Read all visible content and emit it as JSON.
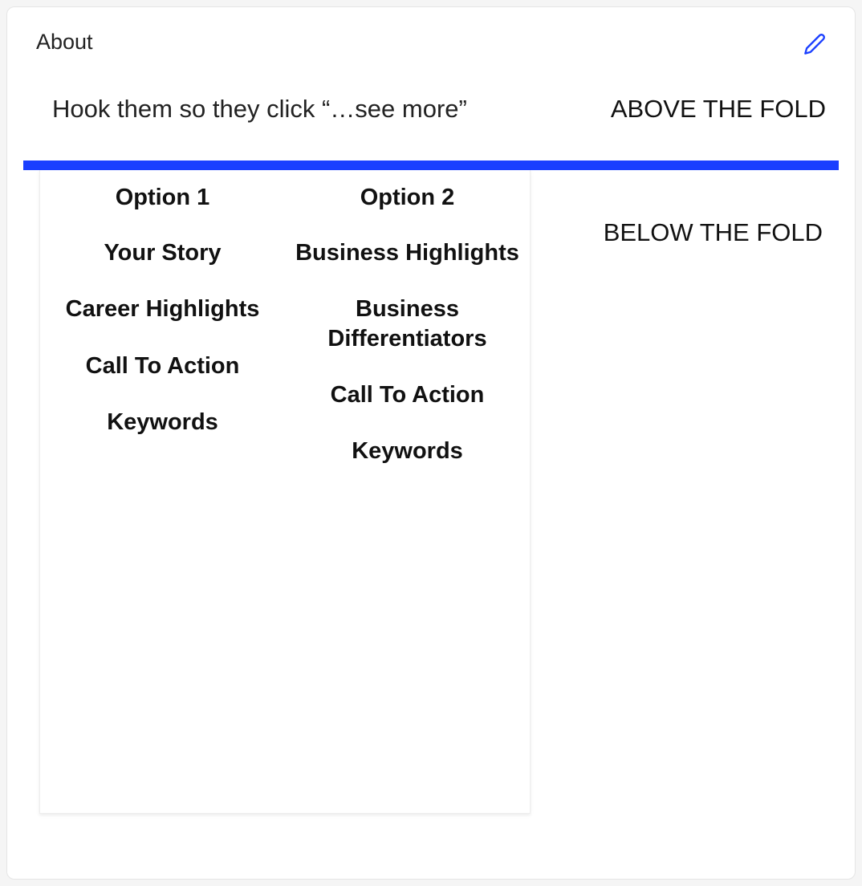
{
  "section": {
    "title": "About",
    "hook": "Hook them so they click “…see more”",
    "aboveFoldLabel": "ABOVE THE FOLD",
    "belowFoldLabel": "BELOW THE FOLD"
  },
  "options": {
    "col1": {
      "title": "Option 1",
      "items": [
        "Your Story",
        "Career Highlights",
        "Call To Action",
        "Keywords"
      ]
    },
    "col2": {
      "title": "Option 2",
      "items": [
        "Business Highlights",
        "Business Differentiators",
        "Call To Action",
        "Keywords"
      ]
    }
  },
  "colors": {
    "accent": "#1a3fff"
  }
}
